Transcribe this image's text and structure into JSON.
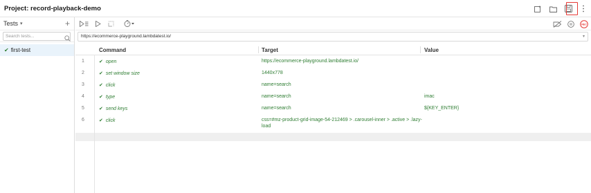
{
  "header": {
    "project_title": "Project:  record-playback-demo"
  },
  "sidebar": {
    "tests_label": "Tests",
    "search_placeholder": "Search tests...",
    "tests": [
      {
        "name": "first-test",
        "status": "passed"
      }
    ]
  },
  "url_bar": {
    "value": "https://ecommerce-playground.lambdatest.io/"
  },
  "table": {
    "columns": [
      "Command",
      "Target",
      "Value"
    ],
    "rows": [
      {
        "index": "1",
        "command": "open",
        "target": "https://ecommerce-playground.lambdatest.io/",
        "value": ""
      },
      {
        "index": "2",
        "command": "set window size",
        "target": "1440x778",
        "value": ""
      },
      {
        "index": "3",
        "command": "click",
        "target": "name=search",
        "value": ""
      },
      {
        "index": "4",
        "command": "type",
        "target": "name=search",
        "value": "imac"
      },
      {
        "index": "5",
        "command": "send keys",
        "target": "name=search",
        "value": "${KEY_ENTER}"
      },
      {
        "index": "6",
        "command": "click",
        "target": "css=#mz-product-grid-image-54-212469 > .carousel-inner > .active > .lazy-load",
        "value": ""
      }
    ]
  },
  "colors": {
    "pass_green": "#2e7d32",
    "highlight_red": "#e53935",
    "selected_bg": "#e9f3fb"
  },
  "icons": [
    "new-window-icon",
    "open-folder-icon",
    "save-icon",
    "more-vertical-icon",
    "run-all-icon",
    "run-icon",
    "step-icon",
    "speed-icon",
    "disable-breakpoints-icon",
    "pause-icon",
    "record-icon",
    "search-icon",
    "check-icon",
    "plus-icon"
  ]
}
